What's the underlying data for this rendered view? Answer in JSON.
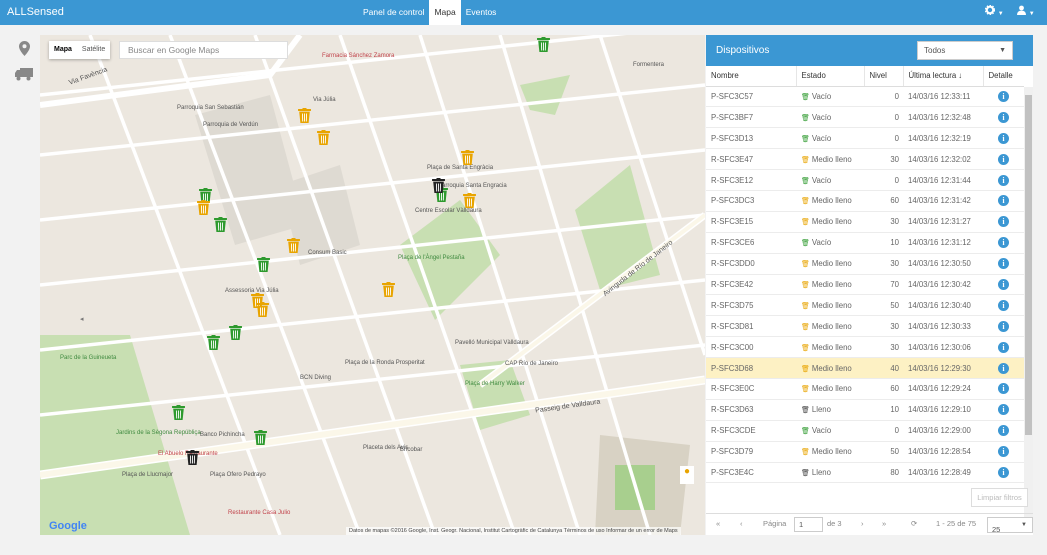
{
  "app": {
    "brand": "ALLSensed"
  },
  "nav": {
    "items": [
      "Panel de control",
      "Mapa",
      "Eventos"
    ],
    "active": "Mapa"
  },
  "header_menus": {
    "settings_icon": "gear-icon",
    "user_icon": "user-icon"
  },
  "leftbar": {
    "icons": [
      "map-pin-icon",
      "truck-icon"
    ]
  },
  "map": {
    "type_buttons": [
      "Mapa",
      "Satélite"
    ],
    "search_placeholder": "Buscar en Google Maps",
    "logo": "Google",
    "footer": "Datos de mapas ©2016 Google, Inst. Geogr. Nacional, Institut Cartogràfic de Catalunya   Términos de uso   Informar de un error de Maps",
    "labels": [
      "Farmacia Sánchez Zamora",
      "Formentera",
      "Parroquia San Sebastián",
      "Parroquia de Verdún",
      "Via Júlia",
      "Plaça de Santa Engràcia",
      "Parroquia Santa Engracia",
      "Centre Escolar Vàlldaura",
      "Consum Basic",
      "Plaça de l'Àngel Pestaña",
      "Assessoria Via Júlia",
      "Pavelló Municipal Vàlldaura",
      "CAP Río de Janeiro",
      "BCN Diving",
      "Plaça de la Ronda Prosperitat",
      "Parc de la Guineueta",
      "Jardins de la Sègona Repúbliça",
      "Banco Pichincha",
      "El Abuelo Restaurante",
      "Plaça de Llucmajor",
      "Plaça Ofero Pedrayo",
      "Restaurante Casa Julio",
      "Bricobar",
      "Plaça de Harry Walker",
      "Passeig de Valldaura",
      "Avinguda de Río de Janeiro",
      "Via Favència",
      "Placeta dels Avis"
    ],
    "bins": [
      {
        "status": "Vacío",
        "color": "#2e9a2e"
      },
      {
        "status": "Medio lleno",
        "color": "#e8a400"
      },
      {
        "status": "Lleno",
        "color": "#222222"
      }
    ]
  },
  "panel": {
    "title": "Dispositivos",
    "filter": "Todos",
    "columns": [
      "Nombre",
      "Estado",
      "Nivel",
      "Última lectura",
      "Detalle"
    ],
    "rows": [
      {
        "name": "P-SFC3C57",
        "status": "Vacío",
        "level": "0",
        "reading": "14/03/16 12:33:11"
      },
      {
        "name": "P-SFC3BF7",
        "status": "Vacío",
        "level": "0",
        "reading": "14/03/16 12:32:48"
      },
      {
        "name": "P-SFC3D13",
        "status": "Vacío",
        "level": "0",
        "reading": "14/03/16 12:32:19"
      },
      {
        "name": "R-SFC3E47",
        "status": "Medio lleno",
        "level": "30",
        "reading": "14/03/16 12:32:02"
      },
      {
        "name": "R-SFC3E12",
        "status": "Vacío",
        "level": "0",
        "reading": "14/03/16 12:31:44"
      },
      {
        "name": "P-SFC3DC3",
        "status": "Medio lleno",
        "level": "60",
        "reading": "14/03/16 12:31:42"
      },
      {
        "name": "R-SFC3E15",
        "status": "Medio lleno",
        "level": "30",
        "reading": "14/03/16 12:31:27"
      },
      {
        "name": "R-SFC3CE6",
        "status": "Vacío",
        "level": "10",
        "reading": "14/03/16 12:31:12"
      },
      {
        "name": "R-SFC3DD0",
        "status": "Medio lleno",
        "level": "30",
        "reading": "14/03/16 12:30:50"
      },
      {
        "name": "R-SFC3E42",
        "status": "Medio lleno",
        "level": "70",
        "reading": "14/03/16 12:30:42"
      },
      {
        "name": "R-SFC3D75",
        "status": "Medio lleno",
        "level": "50",
        "reading": "14/03/16 12:30:40"
      },
      {
        "name": "R-SFC3D81",
        "status": "Medio lleno",
        "level": "30",
        "reading": "14/03/16 12:30:33"
      },
      {
        "name": "R-SFC3C00",
        "status": "Medio lleno",
        "level": "30",
        "reading": "14/03/16 12:30:06"
      },
      {
        "name": "P-SFC3D68",
        "status": "Medio lleno",
        "level": "40",
        "reading": "14/03/16 12:29:30"
      },
      {
        "name": "R-SFC3E0C",
        "status": "Medio lleno",
        "level": "60",
        "reading": "14/03/16 12:29:24"
      },
      {
        "name": "R-SFC3D63",
        "status": "Lleno",
        "level": "10",
        "reading": "14/03/16 12:29:10"
      },
      {
        "name": "R-SFC3CDE",
        "status": "Vacío",
        "level": "0",
        "reading": "14/03/16 12:29:00"
      },
      {
        "name": "P-SFC3D79",
        "status": "Medio lleno",
        "level": "50",
        "reading": "14/03/16 12:28:54"
      },
      {
        "name": "P-SFC3E4C",
        "status": "Lleno",
        "level": "80",
        "reading": "14/03/16 12:28:49"
      }
    ],
    "selected_row": 13,
    "clear_filters": "Limpiar filtros",
    "pager": {
      "page_label": "Página",
      "page": "1",
      "of": "de 3",
      "range": "1 - 25 de 75",
      "size": "25"
    }
  }
}
